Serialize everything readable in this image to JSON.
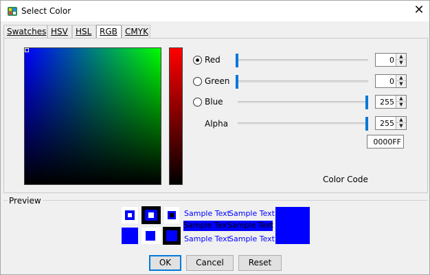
{
  "window": {
    "title": "Select Color",
    "close_glyph": "✕"
  },
  "tabs": [
    {
      "label": "Swatches",
      "active": false
    },
    {
      "label": "HSV",
      "active": false
    },
    {
      "label": "HSL",
      "active": false
    },
    {
      "label": "RGB",
      "active": true
    },
    {
      "label": "CMYK",
      "active": false
    }
  ],
  "rgb": {
    "red": {
      "label": "Red",
      "value": "0",
      "selected": true
    },
    "green": {
      "label": "Green",
      "value": "0",
      "selected": false
    },
    "blue": {
      "label": "Blue",
      "value": "255",
      "selected": false
    },
    "alpha": {
      "label": "Alpha",
      "value": "255"
    }
  },
  "color_code": {
    "label": "Color Code",
    "value": "0000FF"
  },
  "preview": {
    "title": "Preview",
    "sample_text": "Sample Text",
    "color": "#0000ff"
  },
  "buttons": {
    "ok": "OK",
    "cancel": "Cancel",
    "reset": "Reset"
  },
  "colors": {
    "selected": "#0000ff",
    "slider_thumb": "#0078d7",
    "dialog_bg": "#f0f0f0"
  },
  "icons": {
    "app": "color-palette-icon",
    "close": "close-icon",
    "spin_up": "▲",
    "spin_down": "▼"
  }
}
